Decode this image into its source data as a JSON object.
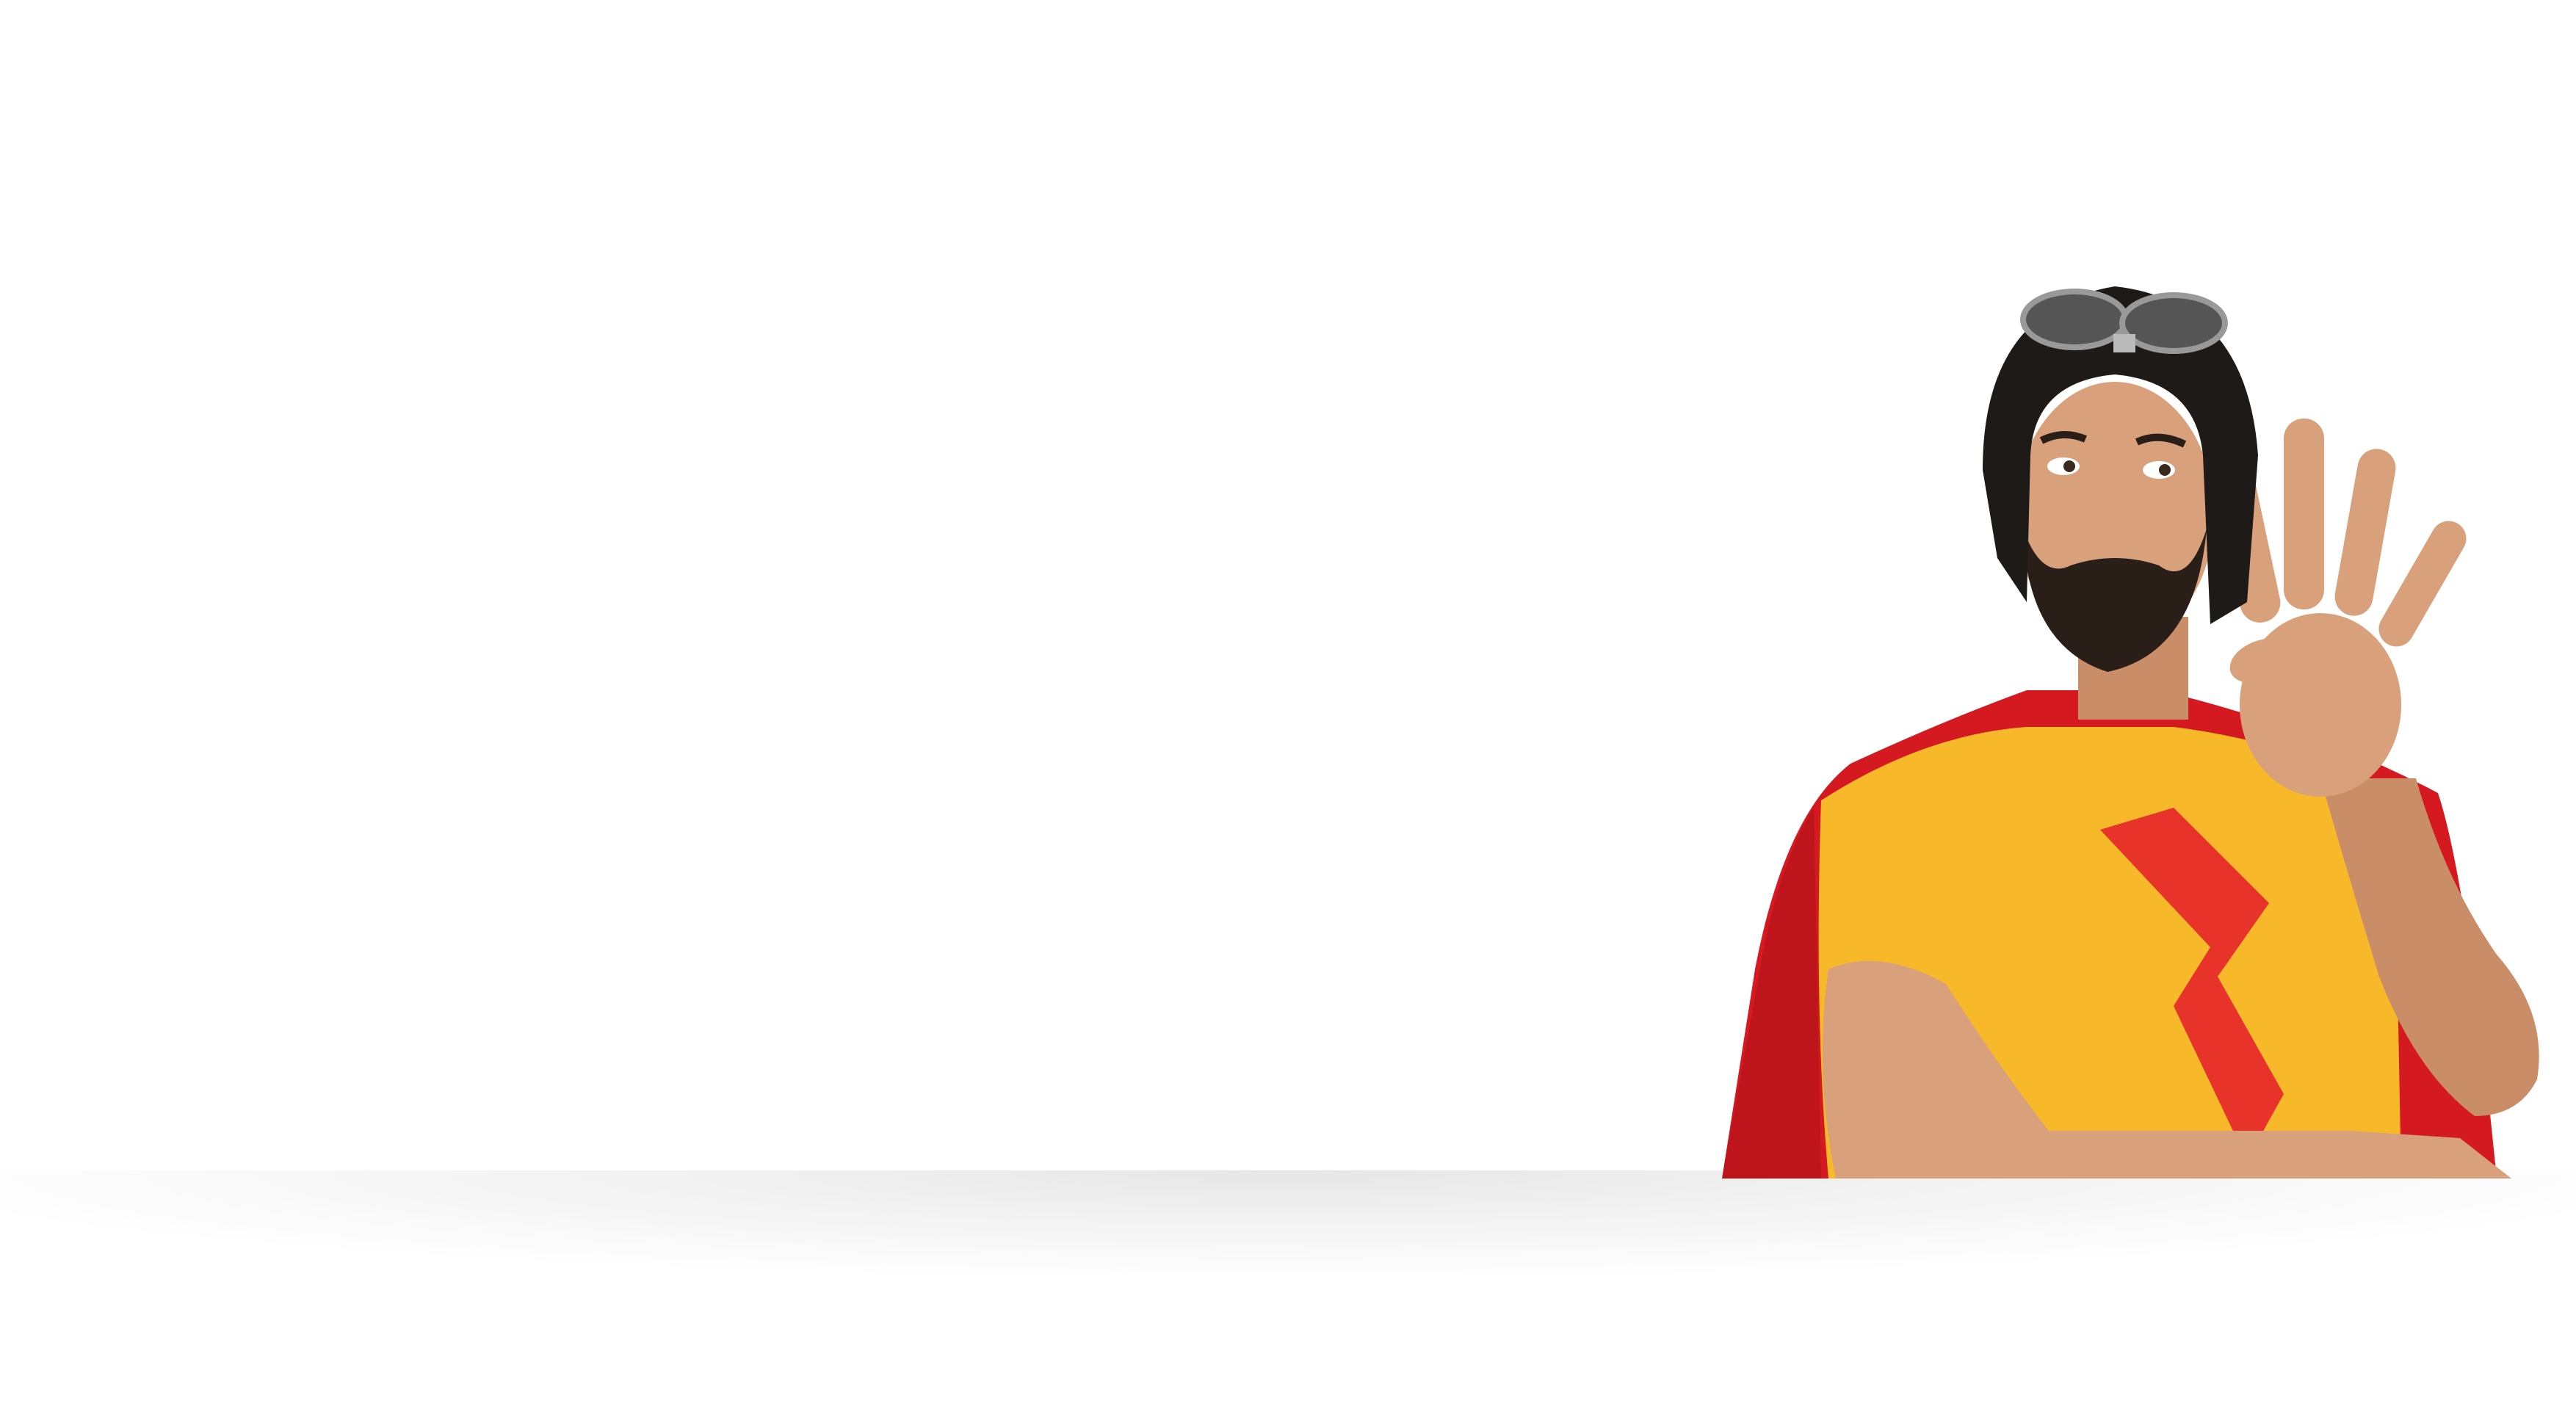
{
  "scene": {
    "background_color": "#ffffff",
    "shadow_color": "#e6e6e6",
    "subject": {
      "cape_color": "#d41920",
      "shirt_color": "#f7b92a",
      "bolt_color": "#e8332a",
      "helmet_color": "#1e1a18",
      "skin_color": "#d9a07c",
      "beard_color": "#2a1e18",
      "fingers_raised": 4
    }
  }
}
